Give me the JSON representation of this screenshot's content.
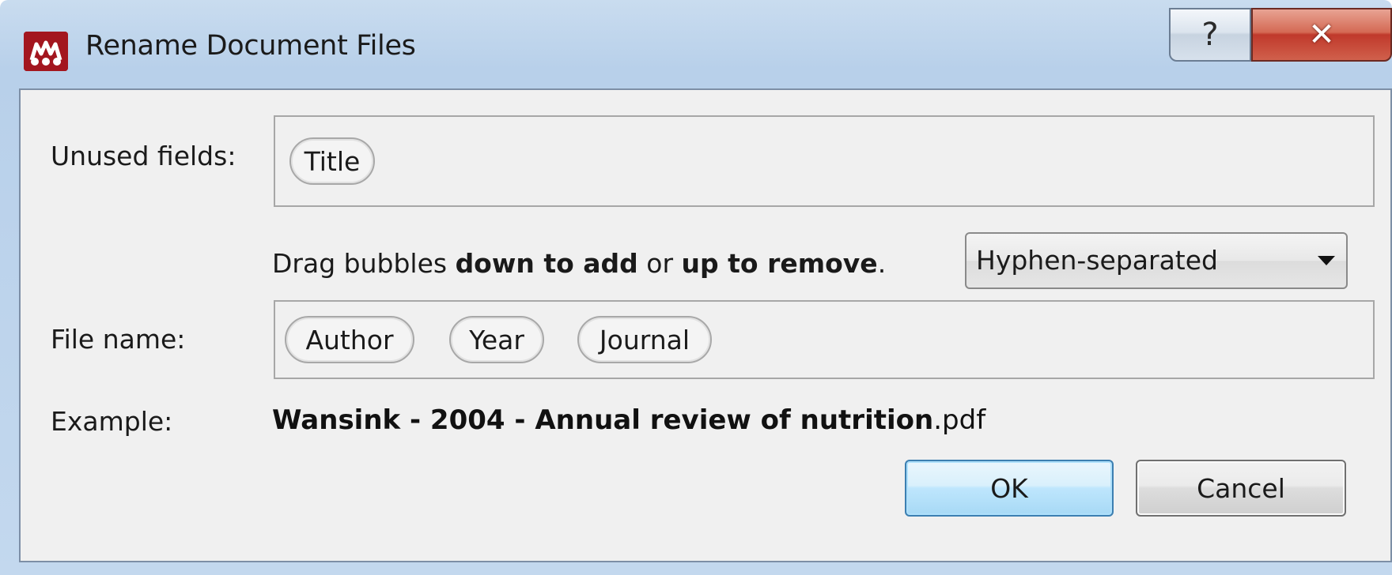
{
  "window": {
    "title": "Rename Document Files",
    "help_glyph": "?",
    "close_glyph": "✕",
    "logo_icon": "mendeley-logo-icon"
  },
  "labels": {
    "unused_fields": "Unused fields:",
    "file_name": "File name:",
    "example": "Example:"
  },
  "unused_bubbles": [
    "Title"
  ],
  "filename_bubbles": [
    "Author",
    "Year",
    "Journal"
  ],
  "hint": {
    "pre": "Drag bubbles ",
    "bold1": "down to add",
    "mid": " or ",
    "bold2": "up to remove",
    "post": "."
  },
  "separator": {
    "selected": "Hyphen-separated"
  },
  "example": {
    "bold": "Wansink - 2004 - Annual review of nutrition",
    "ext": ".pdf"
  },
  "buttons": {
    "ok": "OK",
    "cancel": "Cancel"
  },
  "colors": {
    "logo_red": "#a3161f",
    "close_red": "#c0392b",
    "ok_accent": "#3c7fb1"
  }
}
